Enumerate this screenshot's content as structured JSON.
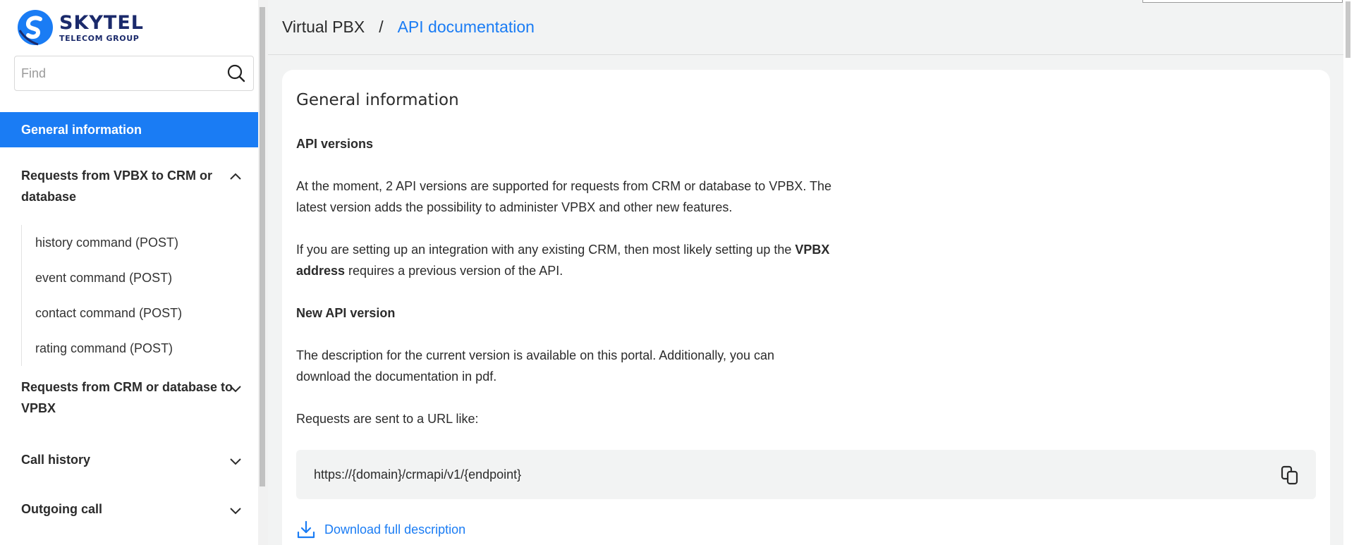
{
  "brand": {
    "name": "SKYTEL",
    "subtitle": "TELECOM GROUP",
    "color": "#1b2a6b",
    "accent": "#1a7cf4"
  },
  "search": {
    "placeholder": "Find"
  },
  "sidebar": {
    "active_item": "General information",
    "groups": [
      {
        "label": "Requests from VPBX to CRM or database",
        "expanded": true,
        "items": [
          "history command (POST)",
          "event command (POST)",
          "contact command (POST)",
          "rating command (POST)"
        ]
      },
      {
        "label": "Requests from CRM or database to VPBX",
        "expanded": false
      },
      {
        "label": "Call history",
        "expanded": false
      },
      {
        "label": "Outgoing call",
        "expanded": false
      }
    ]
  },
  "breadcrumb": {
    "root": "Virtual PBX",
    "separator": "/",
    "current": "API documentation"
  },
  "content": {
    "title": "General information",
    "api_versions_heading": "API versions",
    "p1": "At the moment, 2 API versions are supported for requests from CRM or database to VPBX. The latest version adds the possibility to administer VPBX and other new features.",
    "p2_before": "If you are setting up an integration with any existing CRM, then most likely setting up the ",
    "p2_bold": "VPBX address",
    "p2_after": " requires a previous version of the API.",
    "new_version_heading": "New API version",
    "p3": "The description for the current version is available on this portal. Additionally, you can download the documentation in pdf.",
    "p4": "Requests are sent to a URL like:",
    "url": "https://{domain}/crmapi/v1/{endpoint}",
    "download_label": "Download full description"
  }
}
